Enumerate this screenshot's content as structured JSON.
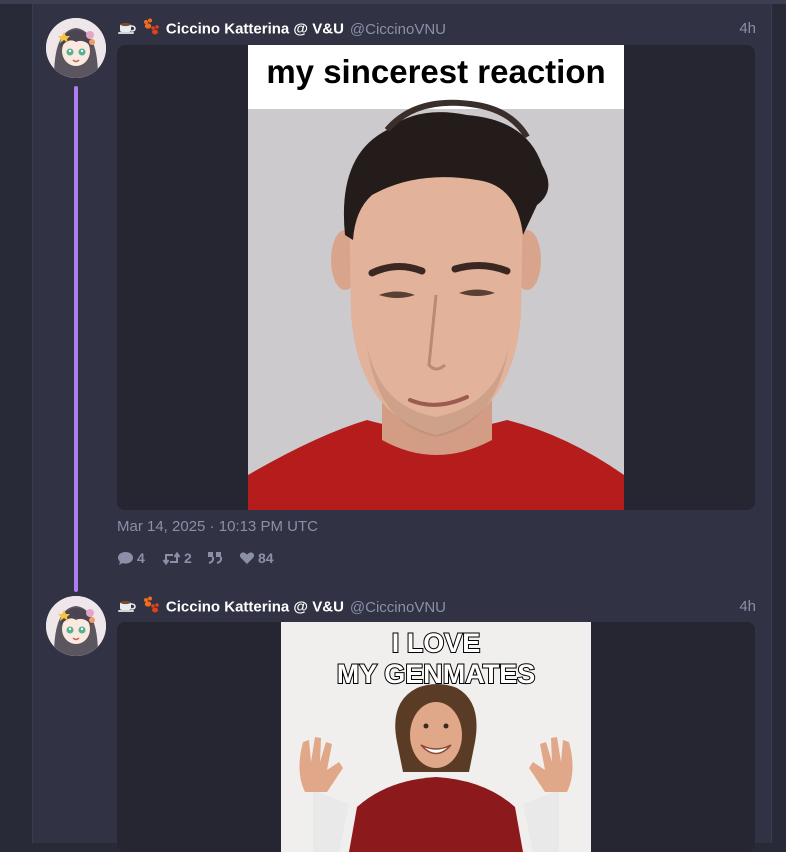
{
  "posts": [
    {
      "display_name": "Ciccino Katterina @ V&U",
      "handle": "@CiccinoVNU",
      "time": "4h",
      "image_caption": "my sincerest reaction",
      "date": "Mar 14, 2025",
      "time_full": "10:13 PM UTC",
      "replies": "4",
      "reposts": "2",
      "likes": "84"
    },
    {
      "display_name": "Ciccino Katterina @ V&U",
      "handle": "@CiccinoVNU",
      "time": "4h",
      "image_caption_line1": "I LOVE",
      "image_caption_line2": "MY GENMATES"
    }
  ],
  "icons": [
    "coffee-emoji-icon",
    "paws-emoji-icon",
    "reply-icon",
    "repost-icon",
    "quote-icon",
    "heart-icon"
  ],
  "colors": {
    "thread_line": "#b07df0",
    "background": "#292a37",
    "column": "#313243",
    "muted_text": "#8b8fa8"
  }
}
